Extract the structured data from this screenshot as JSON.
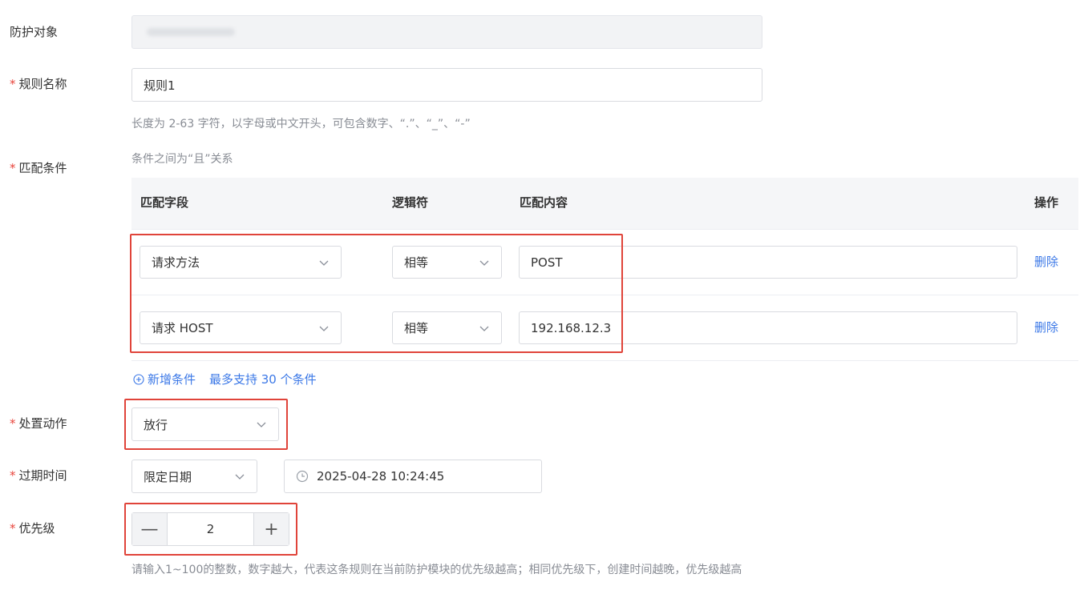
{
  "form": {
    "protect_target": {
      "label": "防护对象",
      "value": ""
    },
    "rule_name": {
      "label": "规则名称",
      "value": "规则1",
      "hint": "长度为 2-63 字符，以字母或中文开头，可包含数字、“.”、“_”、“-”"
    },
    "match": {
      "label": "匹配条件",
      "relation_hint": "条件之间为“且”关系",
      "columns": {
        "field": "匹配字段",
        "operator": "逻辑符",
        "content": "匹配内容",
        "action": "操作"
      },
      "rows": [
        {
          "field": "请求方法",
          "operator": "相等",
          "content": "POST",
          "delete": "删除"
        },
        {
          "field": "请求 HOST",
          "operator": "相等",
          "content": "192.168.12.3",
          "delete": "删除"
        }
      ],
      "add_condition": "新增条件",
      "max_hint": "最多支持 30 个条件"
    },
    "action": {
      "label": "处置动作",
      "value": "放行"
    },
    "expire": {
      "label": "过期时间",
      "mode": "限定日期",
      "datetime": "2025-04-28 10:24:45"
    },
    "priority": {
      "label": "优先级",
      "value": "2",
      "minus": "—",
      "plus": "+",
      "hint": "请输入1~100的整数，数字越大，代表这条规则在当前防护模块的优先级越高；相同优先级下，创建时间越晚，优先级越高"
    }
  },
  "colors": {
    "required_star": "#e8453c",
    "link": "#3b78e7",
    "highlight_box": "#e0443a"
  }
}
